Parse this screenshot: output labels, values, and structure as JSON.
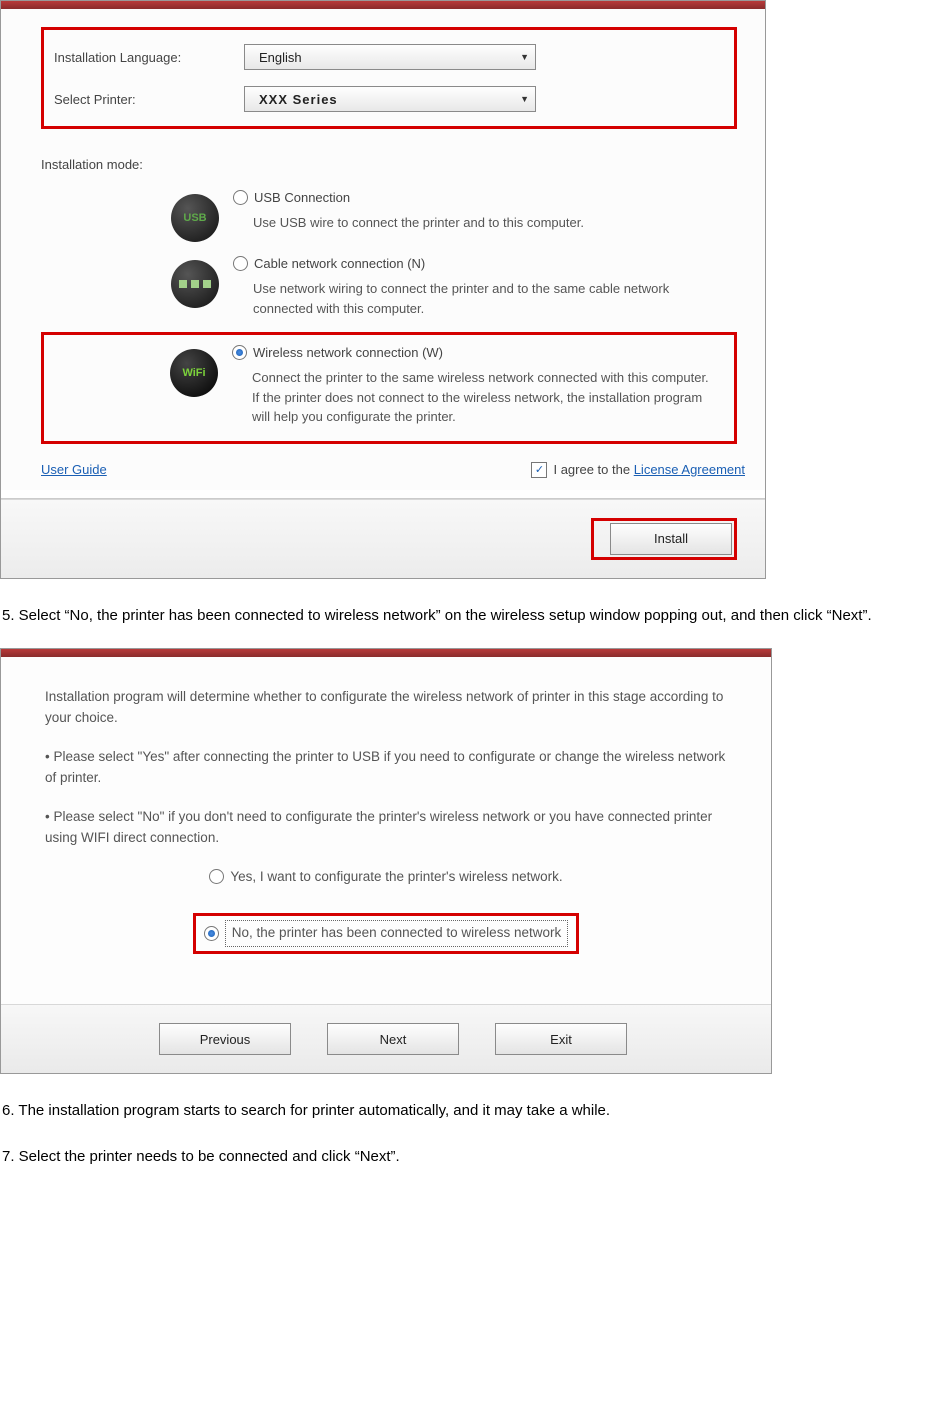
{
  "window1": {
    "labels": {
      "language": "Installation Language:",
      "printer": "Select Printer:",
      "mode": "Installation mode:"
    },
    "dropdowns": {
      "language": "English",
      "printer": "XXX  Series"
    },
    "modes": {
      "usb": {
        "title": "USB Connection",
        "desc": "Use USB wire to connect the printer and to this computer."
      },
      "cable": {
        "title": "Cable network connection (N)",
        "desc": "Use network wiring to connect the printer and to the same cable network connected with this computer."
      },
      "wifi": {
        "title": "Wireless network connection (W)",
        "desc": "Connect the printer to the same wireless network connected with this computer. If the printer does not connect to the wireless network, the installation program will help you configurate the printer."
      }
    },
    "links": {
      "user_guide": "User Guide",
      "license": "License Agreement"
    },
    "agree_prefix": "I agree to the ",
    "install_button": "Install"
  },
  "step5": "5. Select “No, the printer has been connected to wireless network” on the wireless setup window popping out, and then click “Next”.",
  "window2": {
    "intro": "Installation program will determine whether to configurate the wireless network of printer in this stage according to your choice.",
    "bullet_yes": "• Please select \"Yes\" after connecting the printer to USB if you need to configurate or change the wireless network of printer.",
    "bullet_no": "• Please select \"No\" if you don't need to configurate the printer's wireless network or you have connected printer using WIFI direct connection.",
    "option_yes": "Yes, I want to configurate the printer's wireless network.",
    "option_no": "No, the printer has been connected to wireless network",
    "buttons": {
      "prev": "Previous",
      "next": "Next",
      "exit": "Exit"
    }
  },
  "step6": "6. The installation program starts to search for printer automatically, and it may take a while.",
  "step7": "7. Select the printer needs to be connected and click “Next”.",
  "icons": {
    "usb": "USB",
    "wifi": "WiFi"
  }
}
